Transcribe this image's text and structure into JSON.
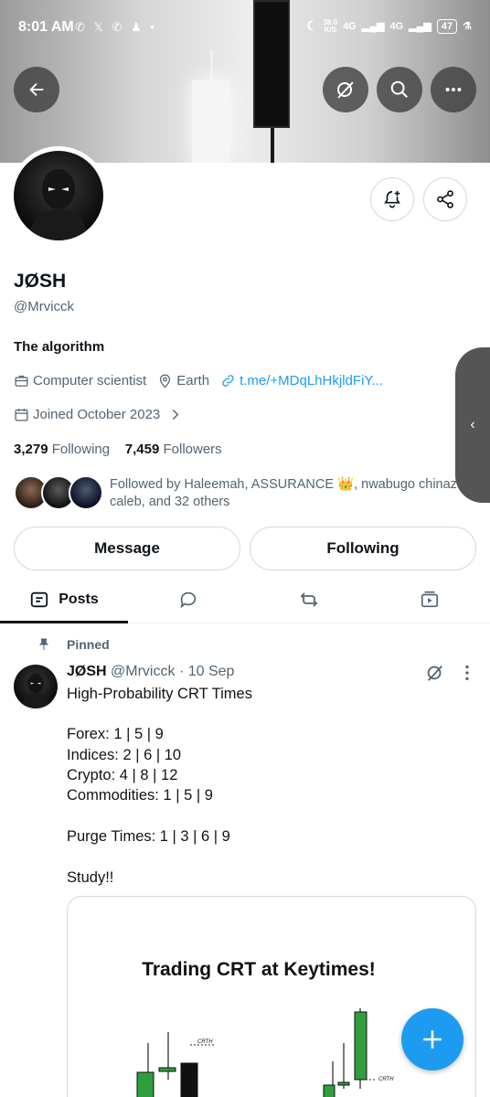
{
  "status_bar": {
    "time": "8:01 AM",
    "net_speed": "38.0",
    "net_unit": "K/S",
    "network_1": "4G",
    "network_2": "4G",
    "battery": "47"
  },
  "header": {
    "back_icon": "arrow-left-icon",
    "grok_icon": "grok-slash-icon",
    "search_icon": "search-icon",
    "more_icon": "more-horizontal-icon"
  },
  "profile": {
    "name": "JØSH",
    "handle": "@Mrvicck",
    "bio": "The algorithm",
    "profession": "Computer scientist",
    "location": "Earth",
    "link": "t.me/+MDqLhHkjldFiY...",
    "joined": "Joined October 2023",
    "following_count": "3,279",
    "following_label": "Following",
    "followers_count": "7,459",
    "followers_label": "Followers",
    "followed_by": "Followed by Haleemah, ASSURANCE 👑, nwabugo chinaza caleb, and 32 others"
  },
  "actions": {
    "message_label": "Message",
    "following_label": "Following"
  },
  "tabs": {
    "posts_label": "Posts"
  },
  "post": {
    "pinned_label": "Pinned",
    "author_name": "JØSH",
    "author_handle": "@Mrvicck",
    "date": "· 10 Sep",
    "lines": [
      "High-Probability CRT Times",
      "Forex: 1 | 5 | 9",
      "Indices: 2 | 6 | 10",
      "Crypto: 4 | 8 | 12",
      "Commodities: 1 | 5 | 9",
      "Purge Times: 1 | 3 | 6 | 9",
      "Study!!"
    ],
    "media_title": "Trading CRT at Keytimes!",
    "crth_label": "CRTH"
  },
  "colors": {
    "accent": "#1d9bf0",
    "text_secondary": "#536471",
    "border": "#cfd9de",
    "candle_green": "#2e9e3e"
  }
}
